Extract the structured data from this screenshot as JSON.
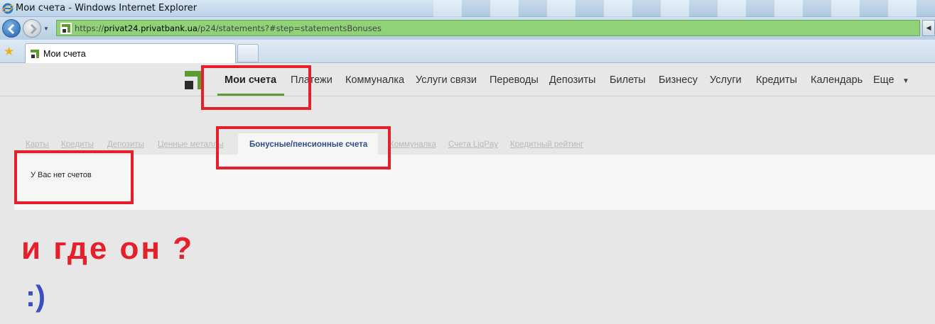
{
  "window": {
    "title": "Мои счета - Windows Internet Explorer"
  },
  "address_bar": {
    "url_scheme": "https://",
    "url_host": "privat24.privatbank.ua",
    "url_path": "/p24/statements?#step=statementsBonuses"
  },
  "tabs": [
    {
      "label": "Мои счета",
      "active": true
    }
  ],
  "main_nav": {
    "items": [
      {
        "label": "Мои счета",
        "active": true
      },
      {
        "label": "Платежи"
      },
      {
        "label": "Коммуналка"
      },
      {
        "label": "Услуги связи"
      },
      {
        "label": "Переводы"
      },
      {
        "label": "Депозиты"
      },
      {
        "label": "Билеты"
      },
      {
        "label": "Бизнесу"
      },
      {
        "label": "Услуги"
      },
      {
        "label": "Кредиты"
      },
      {
        "label": "Календарь"
      },
      {
        "label": "Еще"
      }
    ]
  },
  "sub_tabs": {
    "items": [
      {
        "label": "Карты"
      },
      {
        "label": "Кредиты"
      },
      {
        "label": "Депозиты"
      },
      {
        "label": "Ценные металлы"
      },
      {
        "label": "Бонусные/пенсионные счета",
        "active": true
      },
      {
        "label": "Коммуналка"
      },
      {
        "label": "Счета LiqPay"
      },
      {
        "label": "Кредитный рейтинг"
      }
    ]
  },
  "panel": {
    "message": "У Вас нет счетов"
  },
  "annotations": {
    "question": "и где он ?",
    "smiley": ":)"
  },
  "colors": {
    "accent_green": "#5c9a32",
    "annotation_red": "#e5202a",
    "annotation_blue": "#3b4fc4",
    "active_subtab_text": "#2e4f86"
  }
}
